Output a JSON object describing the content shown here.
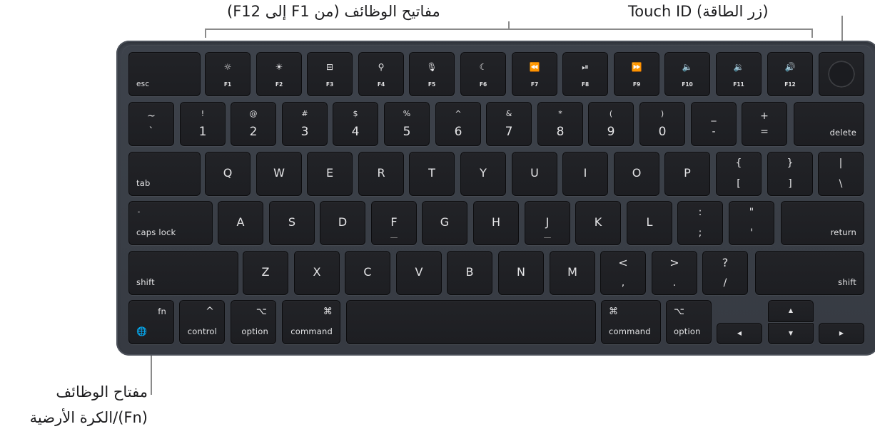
{
  "callouts": {
    "function_keys": "مفاتيح الوظائف (من F1 إلى F12)",
    "touch_id": "Touch ID (زر الطاقة)",
    "fn_line1": "مفتاح الوظائف",
    "fn_line2": "(Fn)/الكرة الأرضية"
  },
  "colors": {
    "frame": "#3a3f47",
    "key": "#1f2024",
    "legend": "#e4e4e6",
    "callout_text": "#1d1d1f",
    "leader_line": "#8a8a8a"
  },
  "row_function": [
    {
      "label": "esc"
    },
    {
      "label": "F1",
      "icon": "☼",
      "icon_name": "brightness-down-icon"
    },
    {
      "label": "F2",
      "icon": "☀",
      "icon_name": "brightness-up-icon"
    },
    {
      "label": "F3",
      "icon": "⊟",
      "icon_name": "mission-control-icon"
    },
    {
      "label": "F4",
      "icon": "⚲",
      "icon_name": "spotlight-search-icon"
    },
    {
      "label": "F5",
      "icon": "🎙",
      "icon_name": "dictation-microphone-icon"
    },
    {
      "label": "F6",
      "icon": "☾",
      "icon_name": "do-not-disturb-moon-icon"
    },
    {
      "label": "F7",
      "icon": "⏪",
      "icon_name": "rewind-icon"
    },
    {
      "label": "F8",
      "icon": "⏯",
      "icon_name": "play-pause-icon"
    },
    {
      "label": "F9",
      "icon": "⏩",
      "icon_name": "fast-forward-icon"
    },
    {
      "label": "F10",
      "icon": "🔈",
      "icon_name": "mute-icon"
    },
    {
      "label": "F11",
      "icon": "🔉",
      "icon_name": "volume-down-icon"
    },
    {
      "label": "F12",
      "icon": "🔊",
      "icon_name": "volume-up-icon"
    },
    {
      "label": "",
      "icon_name": "touch-id-icon"
    }
  ],
  "row_number": [
    {
      "top": "~",
      "bottom": "`"
    },
    {
      "top": "!",
      "bottom": "1"
    },
    {
      "top": "@",
      "bottom": "2"
    },
    {
      "top": "#",
      "bottom": "3"
    },
    {
      "top": "$",
      "bottom": "4"
    },
    {
      "top": "%",
      "bottom": "5"
    },
    {
      "top": "^",
      "bottom": "6"
    },
    {
      "top": "&",
      "bottom": "7"
    },
    {
      "top": "*",
      "bottom": "8"
    },
    {
      "top": "(",
      "bottom": "9"
    },
    {
      "top": ")",
      "bottom": "0"
    },
    {
      "top": "_",
      "bottom": "-"
    },
    {
      "top": "+",
      "bottom": "="
    },
    {
      "label": "delete"
    }
  ],
  "row_qwerty": [
    {
      "label": "tab"
    },
    {
      "letter": "Q"
    },
    {
      "letter": "W"
    },
    {
      "letter": "E"
    },
    {
      "letter": "R"
    },
    {
      "letter": "T"
    },
    {
      "letter": "Y"
    },
    {
      "letter": "U"
    },
    {
      "letter": "I"
    },
    {
      "letter": "O"
    },
    {
      "letter": "P"
    },
    {
      "top": "{",
      "bottom": "["
    },
    {
      "top": "}",
      "bottom": "]"
    },
    {
      "top": "|",
      "bottom": "\\"
    }
  ],
  "row_home": [
    {
      "label": "caps lock"
    },
    {
      "letter": "A"
    },
    {
      "letter": "S"
    },
    {
      "letter": "D"
    },
    {
      "letter": "F"
    },
    {
      "letter": "G"
    },
    {
      "letter": "H"
    },
    {
      "letter": "J"
    },
    {
      "letter": "K"
    },
    {
      "letter": "L"
    },
    {
      "top": ":",
      "bottom": ";"
    },
    {
      "top": "\"",
      "bottom": "'"
    },
    {
      "label": "return"
    }
  ],
  "row_shift": [
    {
      "label": "shift"
    },
    {
      "letter": "Z"
    },
    {
      "letter": "X"
    },
    {
      "letter": "C"
    },
    {
      "letter": "V"
    },
    {
      "letter": "B"
    },
    {
      "letter": "N"
    },
    {
      "letter": "M"
    },
    {
      "top": "<",
      "bottom": ","
    },
    {
      "top": ">",
      "bottom": "."
    },
    {
      "top": "?",
      "bottom": "/"
    },
    {
      "label": "shift"
    }
  ],
  "row_bottom": {
    "fn": {
      "label": "fn",
      "icon": "🌐"
    },
    "control": {
      "label": "control",
      "symbol": "^"
    },
    "option_left": {
      "label": "option",
      "symbol": "⌥"
    },
    "command_left": {
      "label": "command",
      "symbol": "⌘"
    },
    "space": {
      "label": ""
    },
    "command_right": {
      "label": "command",
      "symbol": "⌘"
    },
    "option_right": {
      "label": "option",
      "symbol": "⌥"
    },
    "arrow_left": "◀",
    "arrow_up": "▲",
    "arrow_down": "▼",
    "arrow_right": "▶"
  }
}
